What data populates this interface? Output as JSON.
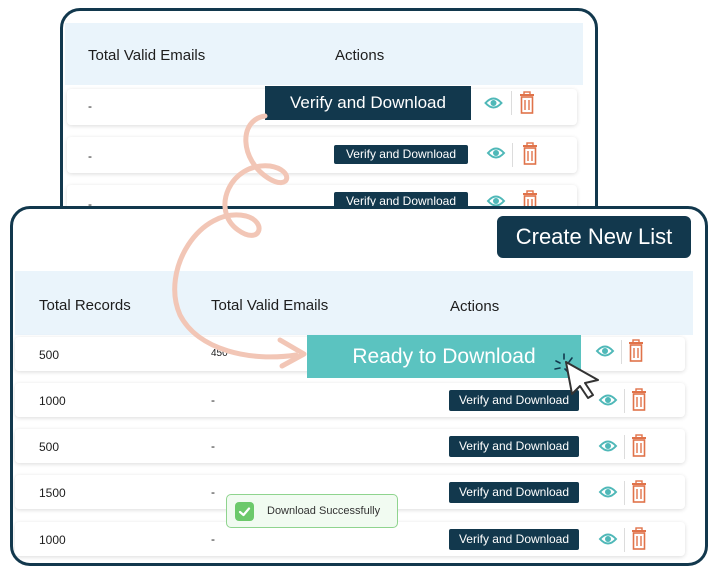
{
  "back_table": {
    "headers": {
      "valid_emails": "Total Valid Emails",
      "actions": "Actions"
    },
    "rows": [
      {
        "valid_emails": "-",
        "action_label": "Verify and Download"
      },
      {
        "valid_emails": "-",
        "action_label": "Verify and Download"
      },
      {
        "valid_emails": "-",
        "action_label": "Verify and Download"
      }
    ]
  },
  "front_table": {
    "create_button": "Create New List",
    "headers": {
      "records": "Total Records",
      "valid_emails": "Total Valid Emails",
      "actions": "Actions"
    },
    "rows": [
      {
        "records": "500",
        "valid_emails": "450",
        "action_label": "Ready to Download"
      },
      {
        "records": "1000",
        "valid_emails": "-",
        "action_label": "Verify and Download"
      },
      {
        "records": "500",
        "valid_emails": "-",
        "action_label": "Verify and Download"
      },
      {
        "records": "1500",
        "valid_emails": "-",
        "action_label": "Verify and Download"
      },
      {
        "records": "1000",
        "valid_emails": "-",
        "action_label": "Verify and Download"
      }
    ]
  },
  "toast": {
    "message": "Download Successfully"
  },
  "colors": {
    "navy": "#12384d",
    "teal": "#5bc3c0",
    "eye_icon": "#4fb8b8",
    "trash_icon": "#e0734a",
    "arrow": "#f2c6b6",
    "header_bg": "#eaf4fb",
    "toast_border": "#8fd48e"
  },
  "icons": {
    "view": "eye-icon",
    "delete": "trash-icon",
    "pointer": "cursor-icon",
    "success": "check-icon"
  }
}
